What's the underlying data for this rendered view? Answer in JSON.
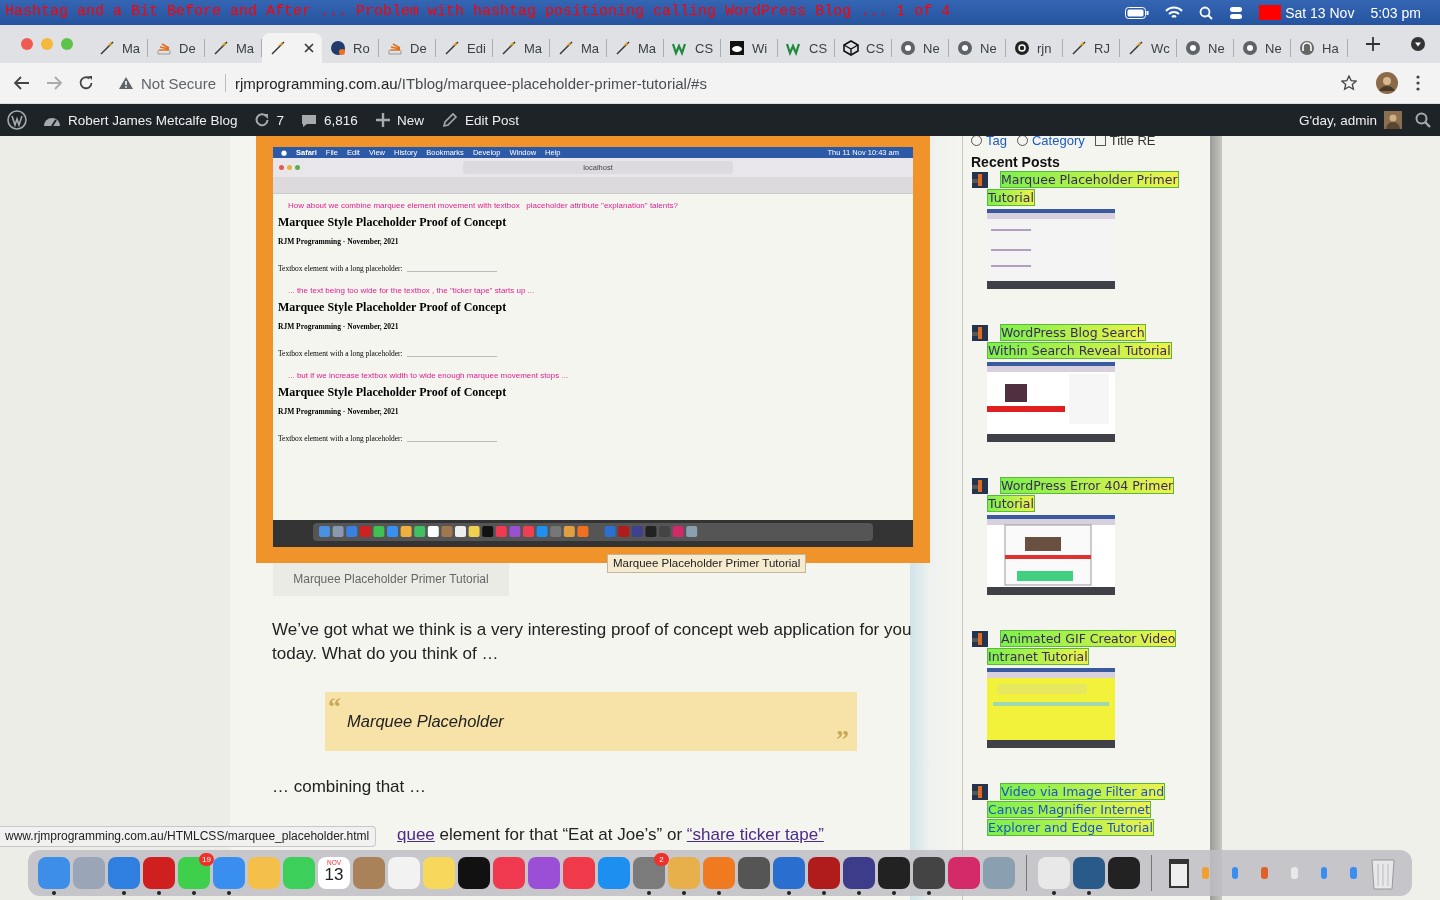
{
  "menubar": {
    "caption": "Hashtag and a Bit Before and After ... Problem with hashtag positioning calling WordPress Blog ... 1 of 4",
    "date": "Sat 13 Nov",
    "time": "5:03 pm"
  },
  "tabs": [
    {
      "label": "Ma",
      "selected": false
    },
    {
      "label": "De",
      "selected": false
    },
    {
      "label": "Ma",
      "selected": false
    },
    {
      "selected": true
    },
    {
      "label": "Ro",
      "selected": false
    },
    {
      "label": "De",
      "selected": false
    },
    {
      "label": "Edi",
      "selected": false
    },
    {
      "label": "Ma",
      "selected": false
    },
    {
      "label": "Ma",
      "selected": false
    },
    {
      "label": "Ma",
      "selected": false
    },
    {
      "label": "CS",
      "selected": false
    },
    {
      "label": "Wi",
      "selected": false
    },
    {
      "label": "CS",
      "selected": false
    },
    {
      "label": "CS",
      "selected": false
    },
    {
      "label": "Ne",
      "selected": false
    },
    {
      "label": "Ne",
      "selected": false
    },
    {
      "label": "rjn",
      "selected": false
    },
    {
      "label": "RJ",
      "selected": false
    },
    {
      "label": "Wc",
      "selected": false
    },
    {
      "label": "Ne",
      "selected": false
    },
    {
      "label": "Ne",
      "selected": false
    },
    {
      "label": "Ha",
      "selected": false
    }
  ],
  "toolbar": {
    "security": "Not Secure",
    "url_host": "rjmprogramming.com.au",
    "url_path": "/ITblog/marquee-placeholder-primer-tutorial/#s"
  },
  "adminbar": {
    "site": "Robert James Metcalfe Blog",
    "updates": "7",
    "comments": "6,816",
    "new": "New",
    "edit": "Edit Post",
    "greeting": "G'day, admin"
  },
  "article": {
    "screenshot": {
      "menus": [
        "Safari",
        "File",
        "Edit",
        "View",
        "History",
        "Bookmarks",
        "Develop",
        "Window",
        "Help"
      ],
      "clock": "Thu 11 Nov  10:43 am",
      "address": "localhost",
      "lines": [
        {
          "kind": "note",
          "text": "How about we combine marquee element movement with textbox   placeholder attribute \"explanation\" talents?"
        },
        {
          "kind": "heading",
          "text": "Marquee Style Placeholder Proof of Concept"
        },
        {
          "kind": "byline",
          "text": "RJM Programming - November, 2021"
        },
        {
          "kind": "field",
          "text": "Textbox element with a long placeholder:"
        },
        {
          "kind": "note",
          "text": "... the text being too wide for the textbox , the \"ticker tape\" starts up ..."
        },
        {
          "kind": "heading",
          "text": "Marquee Style Placeholder Proof of Concept"
        },
        {
          "kind": "byline",
          "text": "RJM Programming - November, 2021"
        },
        {
          "kind": "field",
          "text": "Textbox element with a long placeholder:"
        },
        {
          "kind": "note",
          "text": "... but if we increase textbox width to wide enough marquee movement stops ..."
        },
        {
          "kind": "heading",
          "text": "Marquee Style Placeholder Proof of Concept"
        },
        {
          "kind": "byline",
          "text": "RJM Programming - November, 2021"
        },
        {
          "kind": "field",
          "text": "Textbox element with a long placeholder:"
        }
      ]
    },
    "caption": "Marquee Placeholder Primer Tutorial",
    "tooltip": "Marquee Placeholder Primer Tutorial",
    "intro": "We’ve got what we think is a very interesting proof of concept web application for you today.  What do you think of …",
    "quote": {
      "open": "“",
      "text": "Marquee Placeholder",
      "close": "”"
    },
    "middle": "… combining that …",
    "last": [
      {
        "text": "quee",
        "link": true
      },
      {
        "text": " element for that “Eat at Joe’s” or ",
        "link": false
      },
      {
        "text": "“share ticker tape”",
        "link": true
      }
    ]
  },
  "status_url": "www.rjmprogramming.com.au/HTMLCSS/marquee_placeholder.html",
  "sidebar": {
    "filters": [
      {
        "kind": "radio",
        "label": "Tag",
        "checked": false
      },
      {
        "kind": "radio",
        "label": "Category",
        "checked": false
      },
      {
        "kind": "checkbox",
        "label": "Title RE",
        "checked": false
      }
    ],
    "heading": "Recent Posts",
    "posts": [
      {
        "title": "Marquee Placeholder Primer Tutorial",
        "visited": true
      },
      {
        "title": "WordPress Blog Search Within Search Reveal Tutorial",
        "visited": true
      },
      {
        "title": "WordPress Error 404 Primer Tutorial",
        "visited": true
      },
      {
        "title": "Animated GIF Creator Video Intranet Tutorial",
        "visited": true
      },
      {
        "title": "Video via Image Filter and Canvas Magnifier Internet Explorer and Edge Tutorial",
        "visited": false
      }
    ]
  },
  "dock": {
    "items": [
      {
        "kind": "app",
        "running": true
      },
      {
        "kind": "app",
        "running": false
      },
      {
        "kind": "app",
        "running": true
      },
      {
        "kind": "app",
        "running": true
      },
      {
        "kind": "app",
        "running": true,
        "badge": "19"
      },
      {
        "kind": "app",
        "running": true
      },
      {
        "kind": "app",
        "running": false
      },
      {
        "kind": "app",
        "running": false
      },
      {
        "kind": "calendar",
        "month": "NOV",
        "day": "13",
        "running": false
      },
      {
        "kind": "app",
        "running": false
      },
      {
        "kind": "app",
        "running": false
      },
      {
        "kind": "app",
        "running": false
      },
      {
        "kind": "app",
        "running": false
      },
      {
        "kind": "app",
        "running": false
      },
      {
        "kind": "app",
        "running": false
      },
      {
        "kind": "app",
        "running": false
      },
      {
        "kind": "app",
        "running": false
      },
      {
        "kind": "app",
        "running": true,
        "badge": "2"
      },
      {
        "kind": "app",
        "running": true
      },
      {
        "kind": "app",
        "running": true
      },
      {
        "kind": "app",
        "running": false
      },
      {
        "kind": "app",
        "running": true
      },
      {
        "kind": "app",
        "running": true
      },
      {
        "kind": "app",
        "running": true
      },
      {
        "kind": "app",
        "running": true
      },
      {
        "kind": "app",
        "running": true
      },
      {
        "kind": "app",
        "running": false
      },
      {
        "kind": "app",
        "running": false
      },
      {
        "kind": "separator"
      },
      {
        "kind": "app",
        "running": true
      },
      {
        "kind": "app",
        "running": true
      },
      {
        "kind": "app",
        "running": false
      },
      {
        "kind": "separator"
      },
      {
        "kind": "window"
      },
      {
        "kind": "minimized"
      },
      {
        "kind": "minimized"
      },
      {
        "kind": "minimized"
      },
      {
        "kind": "minimized"
      },
      {
        "kind": "minimized"
      },
      {
        "kind": "minimized"
      },
      {
        "kind": "trash"
      }
    ]
  }
}
